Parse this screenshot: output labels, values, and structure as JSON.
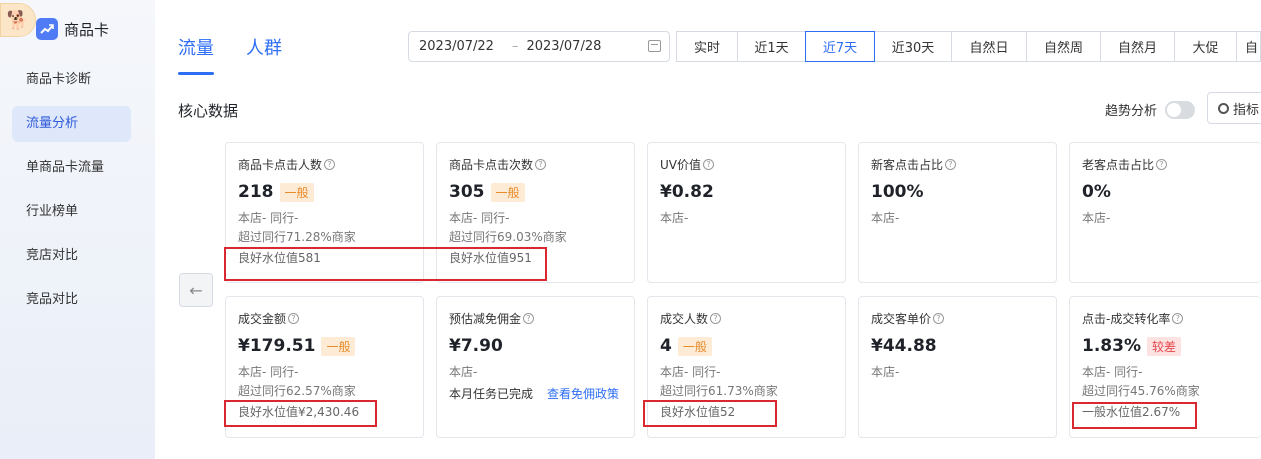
{
  "sidebar": {
    "avatar": "🐕",
    "app_title": "商品卡",
    "items": [
      {
        "label": "商品卡诊断",
        "active": false
      },
      {
        "label": "流量分析",
        "active": true
      },
      {
        "label": "单商品卡流量",
        "active": false
      },
      {
        "label": "行业榜单",
        "active": false
      },
      {
        "label": "竞店对比",
        "active": false
      },
      {
        "label": "竞品对比",
        "active": false
      }
    ]
  },
  "header": {
    "tabs": [
      {
        "label": "流量",
        "active": true
      },
      {
        "label": "人群",
        "active": false
      }
    ],
    "date_start": "2023/07/22",
    "date_sep": "–",
    "date_end": "2023/07/28",
    "periods": [
      {
        "label": "实时"
      },
      {
        "label": "近1天"
      },
      {
        "label": "近7天",
        "active": true
      },
      {
        "label": "近30天"
      },
      {
        "label": "自然日"
      },
      {
        "label": "自然周"
      },
      {
        "label": "自然月"
      },
      {
        "label": "大促"
      },
      {
        "label": "自"
      }
    ]
  },
  "section": {
    "title": "核心数据",
    "trend_label": "趋势分析",
    "metric_btn": "指标"
  },
  "cards": [
    {
      "label": "商品卡点击人数",
      "value": "218",
      "badge": "一般",
      "badge_type": "normal",
      "line1": "本店-  同行-",
      "line2": "超过同行71.28%商家",
      "bench": "良好水位值581"
    },
    {
      "label": "商品卡点击次数",
      "value": "305",
      "badge": "一般",
      "badge_type": "normal",
      "line1": "本店-  同行-",
      "line2": "超过同行69.03%商家",
      "bench": "良好水位值951"
    },
    {
      "label": "UV价值",
      "value": "¥0.82",
      "line1": "本店-"
    },
    {
      "label": "新客点击占比",
      "value": "100%",
      "line1": "本店-"
    },
    {
      "label": "老客点击占比",
      "value": "0%",
      "line1": "本店-"
    },
    {
      "label": "成交金额",
      "value": "¥179.51",
      "badge": "一般",
      "badge_type": "normal",
      "line1": "本店-  同行-",
      "line2": "超过同行62.57%商家",
      "bench": "良好水位值¥2,430.46"
    },
    {
      "label": "预估减免佣金",
      "value": "¥7.90",
      "line1": "本店-",
      "line2": "本月任务已完成",
      "link": "查看免佣政策"
    },
    {
      "label": "成交人数",
      "value": "4",
      "badge": "一般",
      "badge_type": "normal",
      "line1": "本店-  同行-",
      "line2": "超过同行61.73%商家",
      "bench": "良好水位值52"
    },
    {
      "label": "成交客单价",
      "value": "¥44.88",
      "line1": "本店-"
    },
    {
      "label": "点击-成交转化率",
      "value": "1.83%",
      "badge": "较差",
      "badge_type": "poor",
      "line1": "本店-  同行-",
      "line2": "超过同行45.76%商家",
      "bench": "一般水位值2.67%"
    }
  ],
  "colors": {
    "accent": "#2e6ef5",
    "highlight_box": "#d9282f",
    "badge_normal": "#e88b2a",
    "badge_poor": "#e5484d"
  }
}
